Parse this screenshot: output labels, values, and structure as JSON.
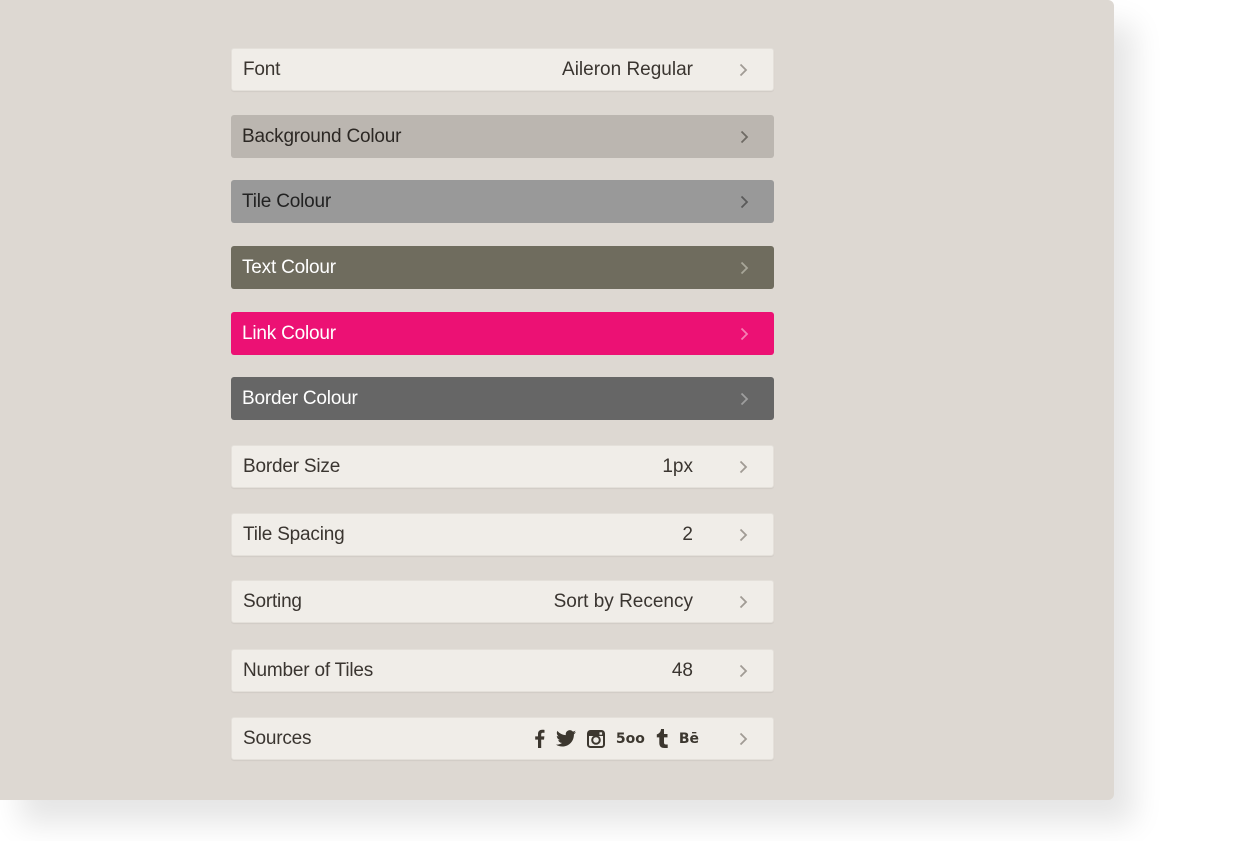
{
  "settings": {
    "font": {
      "label": "Font",
      "value": "Aileron Regular"
    },
    "background_colour": {
      "label": "Background Colour",
      "color": "#bbb6b0",
      "text_color": "#2c2824"
    },
    "tile_colour": {
      "label": "Tile Colour",
      "color": "#999999",
      "text_color": "#222222"
    },
    "text_colour": {
      "label": "Text Colour",
      "color": "#6f6c5e",
      "text_color": "#ffffff"
    },
    "link_colour": {
      "label": "Link Colour",
      "color": "#ec1174",
      "text_color": "#ffffff"
    },
    "border_colour": {
      "label": "Border Colour",
      "color": "#666666",
      "text_color": "#ffffff"
    },
    "border_size": {
      "label": "Border Size",
      "value": "1px"
    },
    "tile_spacing": {
      "label": "Tile Spacing",
      "value": "2"
    },
    "sorting": {
      "label": "Sorting",
      "value": "Sort by Recency"
    },
    "number_of_tiles": {
      "label": "Number of Tiles",
      "value": "48"
    },
    "sources": {
      "label": "Sources",
      "icons": [
        "facebook-icon",
        "twitter-icon",
        "instagram-icon",
        "500px-icon",
        "tumblr-icon",
        "behance-icon"
      ],
      "px500_text": "5oo",
      "behance_text": "Bē"
    }
  },
  "colors": {
    "panel_bg": "#ddd8d2",
    "row_bg": "#f0ede8",
    "chevron": "#a09b94"
  }
}
